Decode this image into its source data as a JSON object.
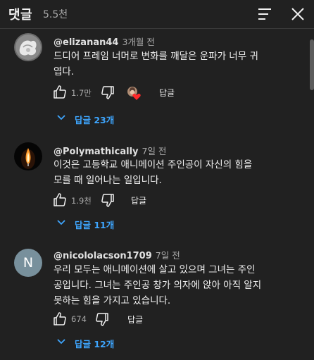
{
  "header": {
    "title": "댓글",
    "count": "5.5천"
  },
  "comments": [
    {
      "author": "@elizanan44",
      "time": "3개월 전",
      "text": "드디어 프레임 너머로 변화를 깨달은 운파가 너무 귀\n엽다.",
      "likes": "1.7만",
      "reply_label": "답글",
      "replies_label": "답글 23개"
    },
    {
      "author": "@Polymathically",
      "time": "7일 전",
      "text": "이것은 고등학교 애니메이션 주인공이 자신의 힘을\n모를 때 일어나는 일입니다.",
      "likes": "1.9천",
      "reply_label": "답글",
      "replies_label": "답글 11개"
    },
    {
      "author": "@nicololacson1709",
      "time": "7일 전",
      "avatar_letter": "N",
      "text": "우리 모두는 애니메이션에 살고 있으며 그녀는 주인\n공입니다. 그녀는 주인공 창가 의자에 앉아 아직 알지\n못하는 힘을 가지고 있습니다.",
      "likes": "674",
      "reply_label": "답글",
      "replies_label": "답글 12개"
    }
  ],
  "colors": {
    "background": "#212121",
    "link": "#3ea6ff",
    "secondary": "#aaaaaa",
    "avatar_n": "#78909c"
  },
  "icons": [
    "sort-icon",
    "close-icon",
    "thumb-up-icon",
    "thumb-down-icon",
    "creator-heart-icon",
    "chevron-down-icon"
  ]
}
